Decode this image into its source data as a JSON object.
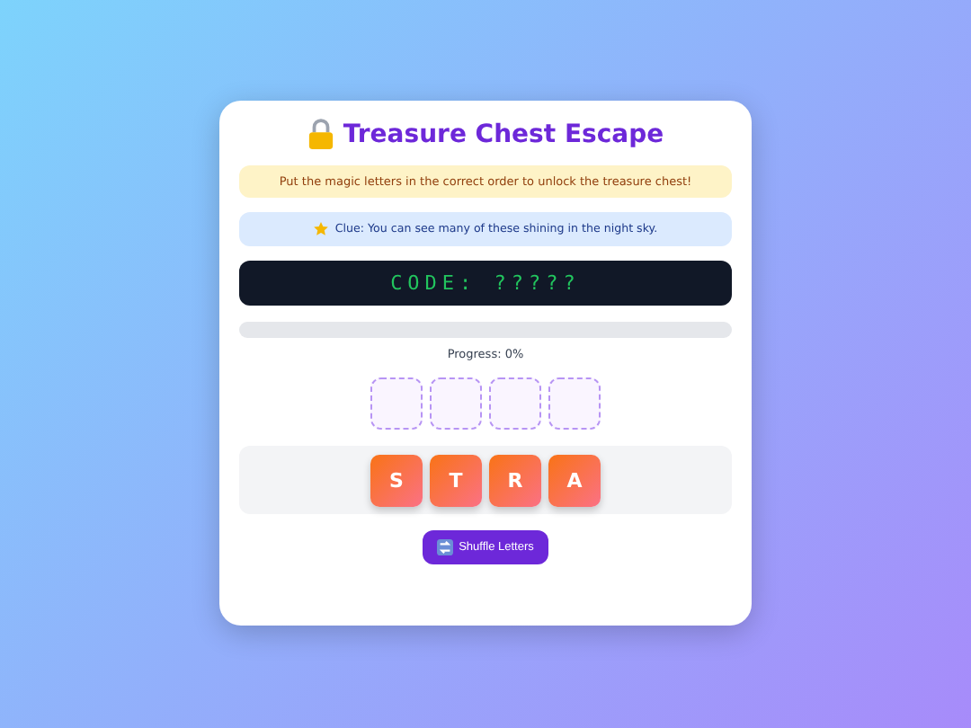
{
  "title": "Treasure Chest Escape",
  "instruction": "Put the magic letters in the correct order to unlock the treasure chest!",
  "clue": "Clue: You can see many of these shining in the night sky.",
  "code": "CODE: ?????",
  "progress": {
    "level": 0,
    "label": "Progress: 0%"
  },
  "slots": [
    {
      "filled": false
    },
    {
      "filled": false
    },
    {
      "filled": false
    },
    {
      "filled": false
    }
  ],
  "letters": [
    "S",
    "T",
    "R",
    "A"
  ],
  "shuffle_button": "Shuffle Letters"
}
